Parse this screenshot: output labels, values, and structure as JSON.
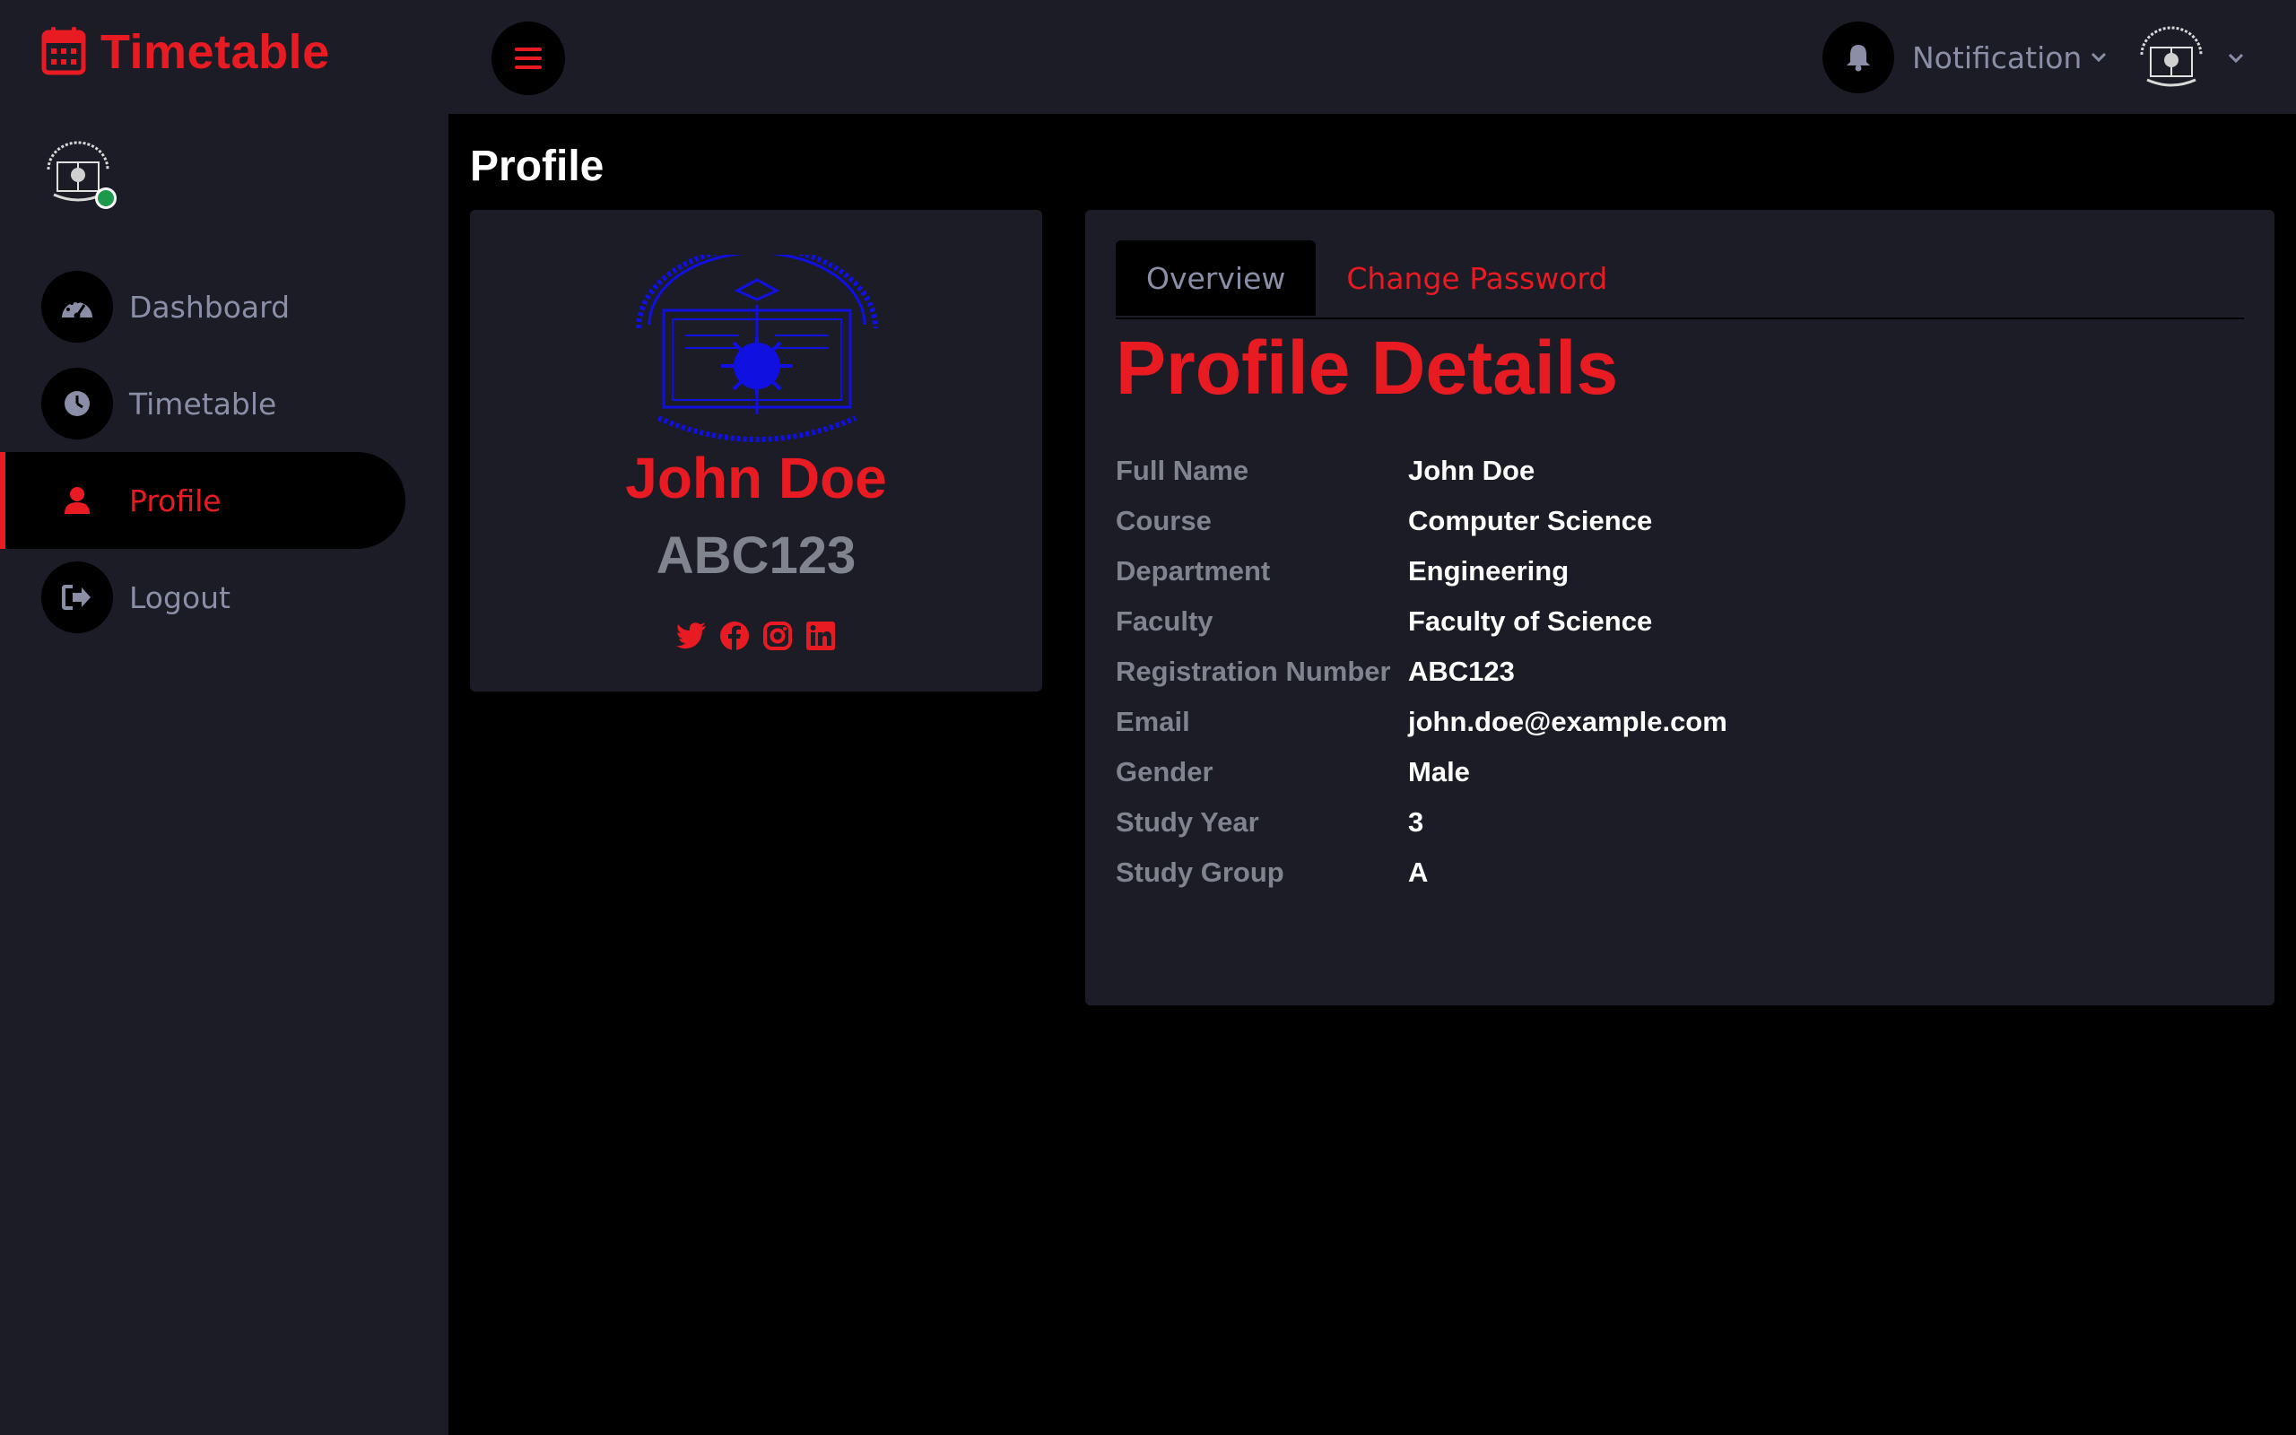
{
  "brand": {
    "title": "Timetable"
  },
  "colors": {
    "accent": "#e81b22",
    "sidebar_bg": "#1b1c26",
    "main_bg": "#000000",
    "muted": "#8a8fa7"
  },
  "sidebar": {
    "avatar_icon": "university-logo",
    "status": "online",
    "items": [
      {
        "label": "Dashboard",
        "icon": "speedometer-icon",
        "active": false
      },
      {
        "label": "Timetable",
        "icon": "clock-icon",
        "active": false
      },
      {
        "label": "Profile",
        "icon": "user-icon",
        "active": true
      },
      {
        "label": "Logout",
        "icon": "logout-icon",
        "active": false
      }
    ]
  },
  "header": {
    "menu_icon": "hamburger-icon",
    "notification_label": "Notification",
    "user_avatar_icon": "university-logo"
  },
  "main": {
    "page_title": "Profile",
    "profile_card": {
      "name": "John Doe",
      "registration": "ABC123",
      "socials": [
        "twitter-icon",
        "facebook-icon",
        "instagram-icon",
        "linkedin-icon"
      ]
    },
    "tabs": [
      {
        "label": "Overview",
        "active": true
      },
      {
        "label": "Change Password",
        "active": false
      }
    ],
    "details_heading": "Profile Details",
    "details": [
      {
        "label": "Full Name",
        "value": "John Doe"
      },
      {
        "label": "Course",
        "value": "Computer Science"
      },
      {
        "label": "Department",
        "value": "Engineering"
      },
      {
        "label": "Faculty",
        "value": "Faculty of Science"
      },
      {
        "label": "Registration Number",
        "value": "ABC123"
      },
      {
        "label": "Email",
        "value": "john.doe@example.com"
      },
      {
        "label": "Gender",
        "value": "Male"
      },
      {
        "label": "Study Year",
        "value": "3"
      },
      {
        "label": "Study Group",
        "value": "A"
      }
    ]
  }
}
